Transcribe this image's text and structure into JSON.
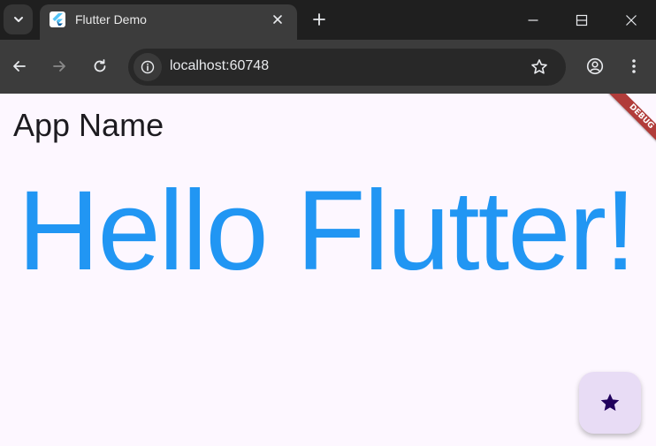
{
  "browser": {
    "tab": {
      "title": "Flutter Demo",
      "favicon": "flutter-logo"
    },
    "address": {
      "url": "localhost:60748"
    },
    "icons": {
      "tab_search": "chevron-down-icon",
      "tab_close": "close-icon",
      "new_tab": "plus-icon",
      "minimize": "minimize-icon",
      "maximize": "maximize-icon",
      "close": "close-icon",
      "back": "back-arrow-icon",
      "forward": "forward-arrow-icon",
      "reload": "reload-icon",
      "site_info": "info-icon",
      "bookmark": "star-outline-icon",
      "profile": "account-icon",
      "menu": "kebab-menu-icon"
    }
  },
  "app": {
    "app_name": "App Name",
    "headline": "Hello Flutter!",
    "debug_banner": "DEBUG",
    "fab_icon": "star-icon",
    "colors": {
      "background": "#fdf7ff",
      "headline": "#2196f3",
      "fab": "#e8dcf5",
      "fab_icon": "#21005d",
      "debug_banner": "#b13c3a"
    }
  }
}
